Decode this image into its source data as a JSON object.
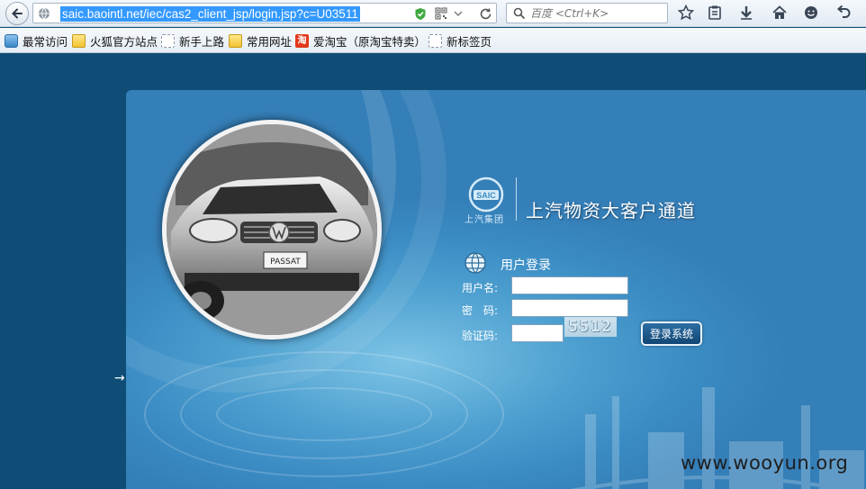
{
  "browser": {
    "url": "saic.baointl.net/iec/cas2_client_jsp/login.jsp?c=U03511",
    "search_placeholder": "百度 <Ctrl+K>"
  },
  "bookmarks": [
    {
      "label": "最常访问",
      "icon": "blue-shortcut-icon"
    },
    {
      "label": "火狐官方站点",
      "icon": "folder-icon"
    },
    {
      "label": "新手上路",
      "icon": "blank-page-icon"
    },
    {
      "label": "常用网址",
      "icon": "folder-icon"
    },
    {
      "label": "爱淘宝（原淘宝特卖）",
      "icon": "taobao-icon",
      "icon_text": "淘"
    },
    {
      "label": "新标签页",
      "icon": "blank-page-icon"
    }
  ],
  "brand": {
    "logo_text": "SAIC",
    "company_cn": "上汽集团",
    "portal_title": "上汽物资大客户通道"
  },
  "login": {
    "heading": "用户登录",
    "username_label": "用户名:",
    "password_label": "密　码:",
    "captcha_label": "验证码:",
    "captcha_text": "5512",
    "submit_label": "登录系统"
  },
  "car_plate": "PASSAT",
  "side_arrow": "→",
  "watermark": "www.wooyun.org",
  "colors": {
    "page_background": "#0f4d76",
    "panel_blue": "#4ea0d0",
    "url_highlight": "#3399ff",
    "button_blue": "#1a5485"
  }
}
